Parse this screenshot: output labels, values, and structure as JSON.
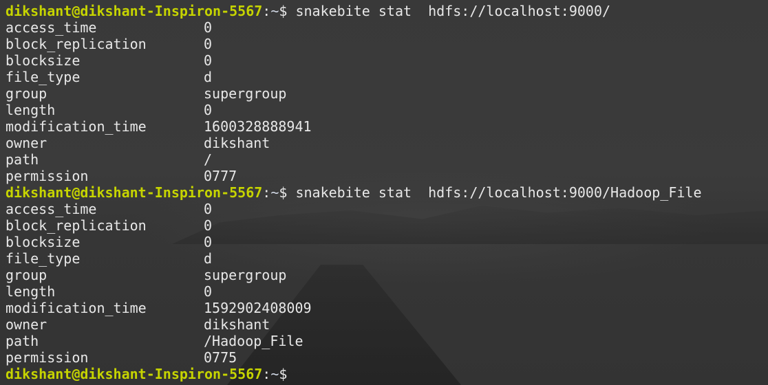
{
  "prompt": {
    "user_host": "dikshant@dikshant-Inspiron-5567",
    "separator": ":",
    "cwd": "~",
    "symbol": "$"
  },
  "blocks": [
    {
      "command": "snakebite stat  hdfs://localhost:9000/",
      "rows": [
        {
          "key": "access_time",
          "value": "0"
        },
        {
          "key": "block_replication",
          "value": "0"
        },
        {
          "key": "blocksize",
          "value": "0"
        },
        {
          "key": "file_type",
          "value": "d"
        },
        {
          "key": "group",
          "value": "supergroup"
        },
        {
          "key": "length",
          "value": "0"
        },
        {
          "key": "modification_time",
          "value": "1600328888941"
        },
        {
          "key": "owner",
          "value": "dikshant"
        },
        {
          "key": "path",
          "value": "/"
        },
        {
          "key": "permission",
          "value": "0777"
        }
      ]
    },
    {
      "command": "snakebite stat  hdfs://localhost:9000/Hadoop_File",
      "rows": [
        {
          "key": "access_time",
          "value": "0"
        },
        {
          "key": "block_replication",
          "value": "0"
        },
        {
          "key": "blocksize",
          "value": "0"
        },
        {
          "key": "file_type",
          "value": "d"
        },
        {
          "key": "group",
          "value": "supergroup"
        },
        {
          "key": "length",
          "value": "0"
        },
        {
          "key": "modification_time",
          "value": "1592902408009"
        },
        {
          "key": "owner",
          "value": "dikshant"
        },
        {
          "key": "path",
          "value": "/Hadoop_File"
        },
        {
          "key": "permission",
          "value": "0775"
        }
      ]
    }
  ],
  "final_prompt_command": ""
}
